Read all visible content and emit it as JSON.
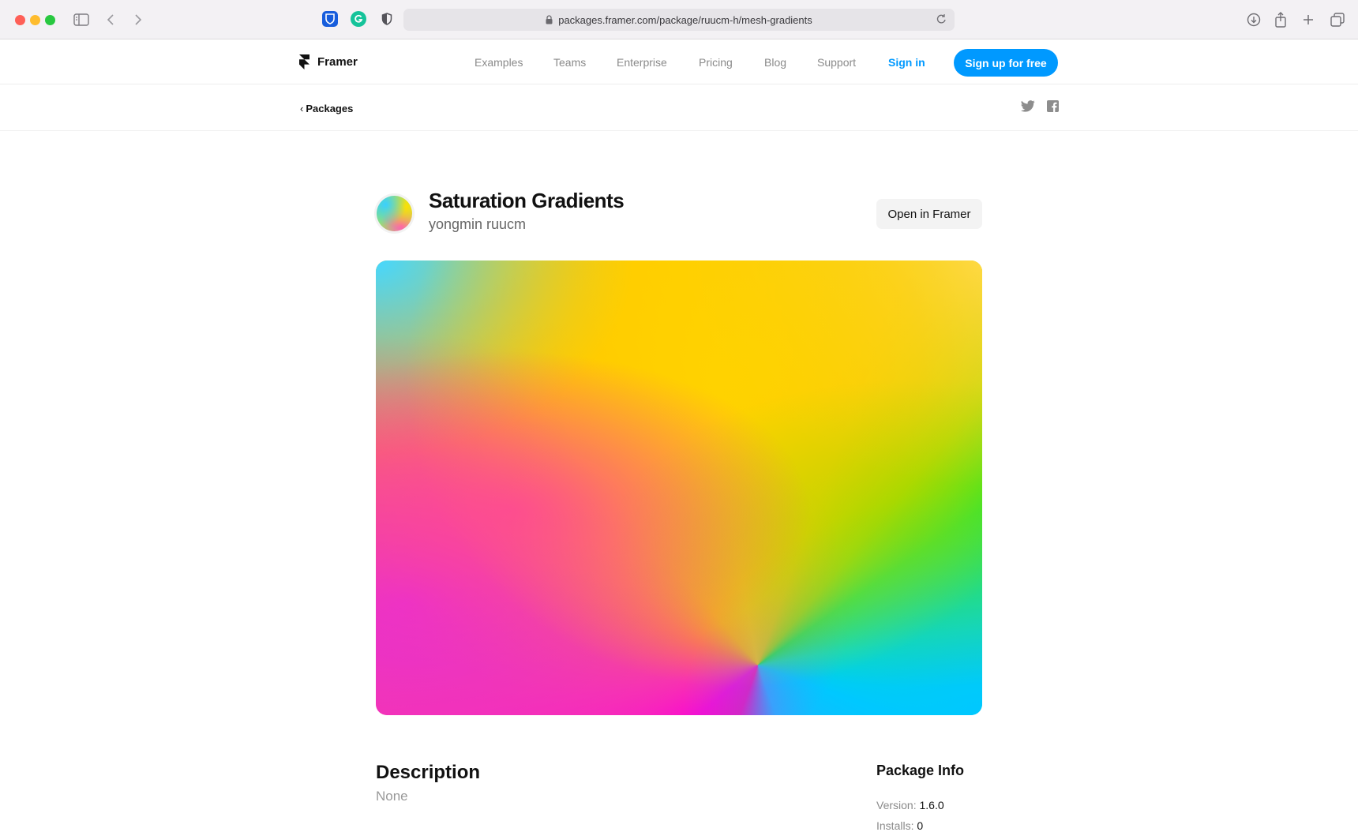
{
  "browser": {
    "url": "packages.framer.com/package/ruucm-h/mesh-gradients"
  },
  "header": {
    "brand": "Framer",
    "nav": [
      "Examples",
      "Teams",
      "Enterprise",
      "Pricing",
      "Blog",
      "Support"
    ],
    "sign_in": "Sign in",
    "sign_up": "Sign up for free",
    "accent_color": "#0099ff"
  },
  "subheader": {
    "back_label": "Packages",
    "back_chevron": "‹"
  },
  "package": {
    "title": "Saturation Gradients",
    "author": "yongmin ruucm",
    "open_button": "Open in Framer"
  },
  "description": {
    "heading": "Description",
    "body": "None"
  },
  "package_info": {
    "heading": "Package Info",
    "version_label": "Version:",
    "version_value": "1.6.0",
    "installs_label": "Installs:",
    "installs_value": "0"
  }
}
